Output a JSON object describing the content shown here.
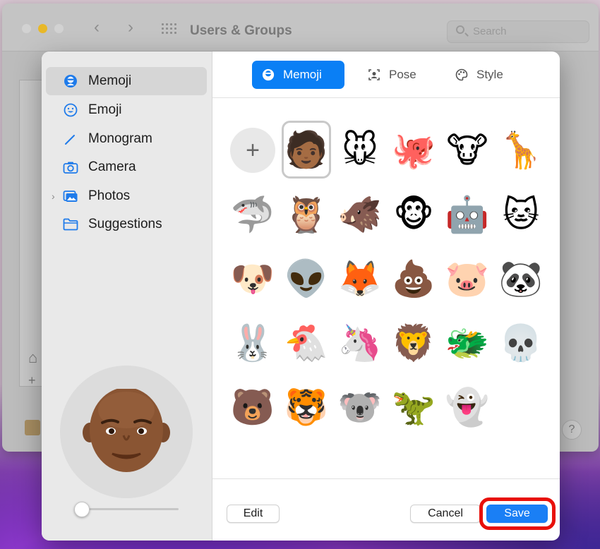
{
  "window": {
    "title": "Users & Groups",
    "search_placeholder": "Search",
    "help_label": "?"
  },
  "sidebar": {
    "items": [
      {
        "label": "Memoji",
        "icon": "memoji-icon",
        "active": true
      },
      {
        "label": "Emoji",
        "icon": "emoji-face-icon"
      },
      {
        "label": "Monogram",
        "icon": "pencil-icon"
      },
      {
        "label": "Camera",
        "icon": "camera-icon"
      },
      {
        "label": "Photos",
        "icon": "photos-icon",
        "expandable": true
      },
      {
        "label": "Suggestions",
        "icon": "folder-icon"
      }
    ]
  },
  "tabs": [
    {
      "label": "Memoji",
      "icon": "memoji-icon",
      "active": true
    },
    {
      "label": "Pose",
      "icon": "pose-icon"
    },
    {
      "label": "Style",
      "icon": "palette-icon"
    }
  ],
  "grid": {
    "add_label": "+",
    "items": [
      {
        "name": "memoji-face",
        "glyph": "🧑🏾"
      },
      {
        "name": "mouse",
        "glyph": "🐭"
      },
      {
        "name": "octopus",
        "glyph": "🐙"
      },
      {
        "name": "cow",
        "glyph": "🐮"
      },
      {
        "name": "giraffe",
        "glyph": "🦒"
      },
      {
        "name": "shark",
        "glyph": "🦈"
      },
      {
        "name": "owl",
        "glyph": "🦉"
      },
      {
        "name": "boar",
        "glyph": "🐗"
      },
      {
        "name": "monkey",
        "glyph": "🐵"
      },
      {
        "name": "robot",
        "glyph": "🤖"
      },
      {
        "name": "cat",
        "glyph": "🐱"
      },
      {
        "name": "dog",
        "glyph": "🐶"
      },
      {
        "name": "alien",
        "glyph": "👽"
      },
      {
        "name": "fox",
        "glyph": "🦊"
      },
      {
        "name": "poop",
        "glyph": "💩"
      },
      {
        "name": "pig",
        "glyph": "🐷"
      },
      {
        "name": "panda",
        "glyph": "🐼"
      },
      {
        "name": "rabbit",
        "glyph": "🐰"
      },
      {
        "name": "chicken",
        "glyph": "🐔"
      },
      {
        "name": "unicorn",
        "glyph": "🦄"
      },
      {
        "name": "lion",
        "glyph": "🦁"
      },
      {
        "name": "dragon",
        "glyph": "🐲"
      },
      {
        "name": "skull",
        "glyph": "💀"
      },
      {
        "name": "bear",
        "glyph": "🐻"
      },
      {
        "name": "tiger",
        "glyph": "🐯"
      },
      {
        "name": "koala",
        "glyph": "🐨"
      },
      {
        "name": "t-rex",
        "glyph": "🦖"
      },
      {
        "name": "ghost",
        "glyph": "👻"
      }
    ]
  },
  "footer": {
    "edit_label": "Edit",
    "cancel_label": "Cancel",
    "save_label": "Save"
  },
  "colors": {
    "accent": "#0a7ff5",
    "highlight": "#e8100a"
  }
}
